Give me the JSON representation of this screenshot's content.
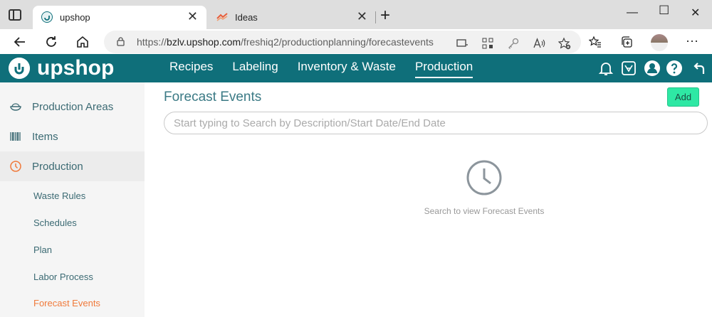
{
  "browser": {
    "tabs": [
      {
        "title": "upshop",
        "active": true
      },
      {
        "title": "Ideas",
        "active": false
      }
    ],
    "url_prefix": "https://",
    "url_host": "bzlv.upshop.com",
    "url_path": "/freshiq2/productionplanning/forecastevents"
  },
  "app": {
    "logo_text": "upshop",
    "brand_color": "#0f6f7a",
    "nav": [
      "Recipes",
      "Labeling",
      "Inventory & Waste",
      "Production"
    ],
    "active_nav": "Production"
  },
  "sidebar": {
    "items": [
      {
        "label": "Production Areas",
        "icon": "bowl-icon"
      },
      {
        "label": "Items",
        "icon": "barcode-icon"
      },
      {
        "label": "Production",
        "icon": "clock-icon"
      }
    ],
    "subitems": [
      "Waste Rules",
      "Schedules",
      "Plan",
      "Labor Process",
      "Forecast Events"
    ],
    "active_subitem": "Forecast Events"
  },
  "content": {
    "title": "Forecast Events",
    "add_label": "Add",
    "search_placeholder": "Start typing to Search by Description/Start Date/End Date",
    "empty_text": "Search to view Forecast Events"
  }
}
